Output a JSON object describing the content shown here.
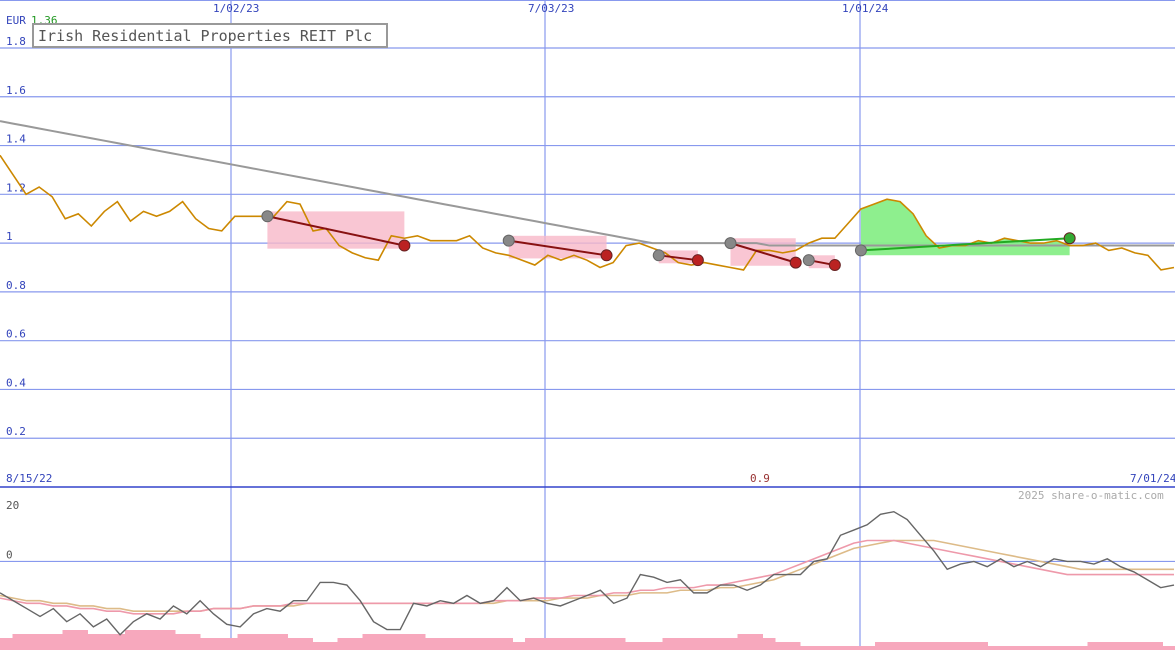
{
  "chart_data": {
    "type": "line",
    "title": "Irish Residential Properties REIT Plc",
    "currency": "EUR",
    "last_price_label": "1.36",
    "watermark": "2025 share-o-matic.com",
    "top_date_labels": [
      "1/02/23",
      "7/03/23",
      "1/01/24"
    ],
    "start_date_label": "8/15/22",
    "end_date_label": "7/01/24",
    "mid_value_label": "0.9",
    "price_panel": {
      "ylim": [
        0,
        1.8
      ],
      "y_ticks": [
        "1.8",
        "1.6",
        "1.4",
        "1.2",
        "1",
        "0.8",
        "0.6",
        "0.4",
        "0.2"
      ],
      "dates_index_note_x_range": [
        0,
        100
      ],
      "price": {
        "name": "price",
        "color": "#cc8800",
        "x": [
          0,
          1,
          2,
          3,
          4,
          5,
          6,
          7,
          8,
          9,
          10,
          11,
          12,
          13,
          14,
          15,
          16,
          17,
          18,
          19,
          20,
          21,
          22,
          23,
          24,
          25,
          26,
          27,
          28,
          29,
          30,
          31,
          32,
          33,
          34,
          35,
          36,
          37,
          38,
          39,
          40,
          41,
          42,
          43,
          44,
          45,
          46,
          47,
          48,
          49,
          50,
          51,
          52,
          53,
          54,
          55,
          56,
          57,
          58,
          59,
          60,
          61,
          62,
          63,
          64,
          65,
          66,
          67,
          68,
          69,
          70,
          71,
          72,
          73,
          74,
          75,
          76,
          77,
          78,
          79,
          80,
          81,
          82,
          83,
          84,
          85,
          86,
          87,
          88,
          89,
          90,
          91,
          92,
          93,
          94,
          95,
          96,
          97,
          98,
          99,
          100
        ],
        "y": [
          1.36,
          1.28,
          1.2,
          1.23,
          1.19,
          1.1,
          1.12,
          1.07,
          1.13,
          1.17,
          1.09,
          1.13,
          1.11,
          1.13,
          1.17,
          1.1,
          1.06,
          1.05,
          1.11,
          1.11,
          1.11,
          1.11,
          1.17,
          1.16,
          1.05,
          1.06,
          0.99,
          0.96,
          0.94,
          0.93,
          1.03,
          1.02,
          1.03,
          1.01,
          1.01,
          1.01,
          1.03,
          0.98,
          0.96,
          0.95,
          0.93,
          0.91,
          0.95,
          0.93,
          0.95,
          0.93,
          0.9,
          0.92,
          0.99,
          1.0,
          0.98,
          0.96,
          0.92,
          0.91,
          0.92,
          0.91,
          0.9,
          0.89,
          0.97,
          0.97,
          0.96,
          0.97,
          1.0,
          1.02,
          1.02,
          1.08,
          1.14,
          1.16,
          1.18,
          1.17,
          1.12,
          1.03,
          0.98,
          0.99,
          0.99,
          1.01,
          1.0,
          1.02,
          1.01,
          1.0,
          1.0,
          1.01,
          0.99,
          0.99,
          1.0,
          0.97,
          0.98,
          0.96,
          0.95,
          0.89,
          0.9
        ],
        "ma": [
          1.5,
          1.49,
          1.48,
          1.47,
          1.46,
          1.45,
          1.44,
          1.43,
          1.42,
          1.41,
          1.4,
          1.39,
          1.38,
          1.37,
          1.36,
          1.35,
          1.34,
          1.33,
          1.32,
          1.31,
          1.3,
          1.29,
          1.28,
          1.27,
          1.26,
          1.25,
          1.24,
          1.23,
          1.22,
          1.21,
          1.2,
          1.19,
          1.18,
          1.17,
          1.16,
          1.15,
          1.14,
          1.13,
          1.12,
          1.11,
          1.1,
          1.09,
          1.08,
          1.07,
          1.06,
          1.05,
          1.04,
          1.03,
          1.02,
          1.01,
          1.0,
          1.0,
          1.0,
          1.0,
          1.0,
          1.0,
          1.0,
          1.0,
          1.0,
          0.99,
          0.99,
          0.99,
          0.99,
          0.99,
          0.99,
          0.99,
          0.99,
          0.99,
          0.99,
          0.99,
          0.99,
          0.99,
          0.99,
          0.99,
          0.99,
          0.99,
          0.99,
          0.99,
          0.99,
          0.99,
          0.99,
          0.99,
          0.99,
          0.99,
          0.99,
          0.99,
          0.99,
          0.99,
          0.99,
          0.99,
          0.99
        ]
      },
      "trades": [
        {
          "from_x": 20.5,
          "from_y": 1.11,
          "to_x": 31,
          "to_y": 0.99,
          "result": "loss"
        },
        {
          "from_x": 39,
          "from_y": 1.01,
          "to_x": 46.5,
          "to_y": 0.95,
          "result": "loss"
        },
        {
          "from_x": 50.5,
          "from_y": 0.95,
          "to_x": 53.5,
          "to_y": 0.93,
          "result": "loss"
        },
        {
          "from_x": 56,
          "from_y": 1.0,
          "to_x": 61,
          "to_y": 0.92,
          "result": "loss"
        },
        {
          "from_x": 62,
          "from_y": 0.93,
          "to_x": 64,
          "to_y": 0.91,
          "result": "loss"
        },
        {
          "from_x": 66,
          "from_y": 0.97,
          "to_x": 82,
          "to_y": 1.02,
          "result": "gain"
        }
      ]
    },
    "indicator_panel": {
      "ylim": [
        -30,
        25
      ],
      "y_ticks": [
        "20",
        "0",
        "-30"
      ],
      "momentum": {
        "color": "#666666",
        "y": [
          -12,
          -15,
          -18,
          -21,
          -18,
          -23,
          -20,
          -25,
          -22,
          -28,
          -23,
          -20,
          -22,
          -17,
          -20,
          -15,
          -20,
          -24,
          -25,
          -20,
          -18,
          -19,
          -15,
          -15,
          -8,
          -8,
          -9,
          -15,
          -23,
          -26,
          -26,
          -16,
          -17,
          -15,
          -16,
          -13,
          -16,
          -15,
          -10,
          -15,
          -14,
          -16,
          -17,
          -15,
          -13,
          -11,
          -16,
          -14,
          -5,
          -6,
          -8,
          -7,
          -12,
          -12,
          -9,
          -9,
          -11,
          -9,
          -5,
          -5,
          -5,
          0,
          1,
          10,
          12,
          14,
          18,
          19,
          16,
          10,
          4,
          -3,
          -1,
          0,
          -2,
          1,
          -2,
          0,
          -2,
          1,
          0,
          0,
          -1,
          1,
          -2,
          -4,
          -7,
          -10,
          -9
        ]
      },
      "signal_pink": {
        "color": "#ee99aa",
        "y": [
          -14,
          -15,
          -16,
          -16,
          -17,
          -17,
          -18,
          -18,
          -19,
          -19,
          -20,
          -20,
          -20,
          -20,
          -19,
          -19,
          -18,
          -18,
          -18,
          -17,
          -17,
          -17,
          -16,
          -16,
          -16,
          -16,
          -16,
          -16,
          -16,
          -16,
          -16,
          -16,
          -16,
          -16,
          -16,
          -16,
          -16,
          -15,
          -15,
          -15,
          -14,
          -14,
          -14,
          -13,
          -13,
          -13,
          -12,
          -12,
          -11,
          -11,
          -10,
          -10,
          -10,
          -9,
          -9,
          -8,
          -7,
          -6,
          -5,
          -3,
          -1,
          1,
          3,
          5,
          7,
          8,
          8,
          8,
          7,
          6,
          5,
          4,
          3,
          2,
          1,
          0,
          -1,
          -2,
          -3,
          -4,
          -5,
          -5,
          -5,
          -5,
          -5,
          -5,
          -5,
          -5,
          -5
        ]
      },
      "signal_tan": {
        "color": "#ddbb88",
        "y": [
          -13,
          -14,
          -15,
          -15,
          -16,
          -16,
          -17,
          -17,
          -18,
          -18,
          -19,
          -19,
          -19,
          -19,
          -19,
          -19,
          -18,
          -18,
          -18,
          -17,
          -17,
          -17,
          -17,
          -16,
          -16,
          -16,
          -16,
          -16,
          -16,
          -16,
          -16,
          -16,
          -16,
          -16,
          -16,
          -16,
          -16,
          -16,
          -15,
          -15,
          -15,
          -15,
          -14,
          -14,
          -14,
          -13,
          -13,
          -13,
          -12,
          -12,
          -12,
          -11,
          -11,
          -11,
          -10,
          -10,
          -9,
          -8,
          -7,
          -5,
          -3,
          -1,
          1,
          3,
          5,
          6,
          7,
          8,
          8,
          8,
          8,
          7,
          6,
          5,
          4,
          3,
          2,
          1,
          0,
          -1,
          -2,
          -3,
          -3,
          -3,
          -3,
          -3,
          -3,
          -3,
          -3
        ]
      },
      "volume": {
        "color": "#f7a8bd",
        "y": [
          3,
          4,
          4,
          4,
          4,
          5,
          5,
          4,
          4,
          4,
          5,
          5,
          5,
          5,
          4,
          4,
          3,
          3,
          3,
          4,
          4,
          4,
          4,
          3,
          3,
          2,
          2,
          3,
          3,
          4,
          4,
          4,
          4,
          4,
          3,
          3,
          3,
          3,
          3,
          3,
          3,
          2,
          3,
          3,
          3,
          3,
          3,
          3,
          3,
          3,
          2,
          2,
          2,
          3,
          3,
          3,
          3,
          3,
          3,
          4,
          4,
          3,
          2,
          2,
          1,
          1,
          1,
          1,
          1,
          1,
          2,
          2,
          2,
          2,
          2,
          2,
          2,
          2,
          2,
          1,
          1,
          1,
          1,
          1,
          1,
          1,
          1,
          2,
          2,
          2,
          2,
          2,
          2,
          1
        ]
      }
    }
  }
}
